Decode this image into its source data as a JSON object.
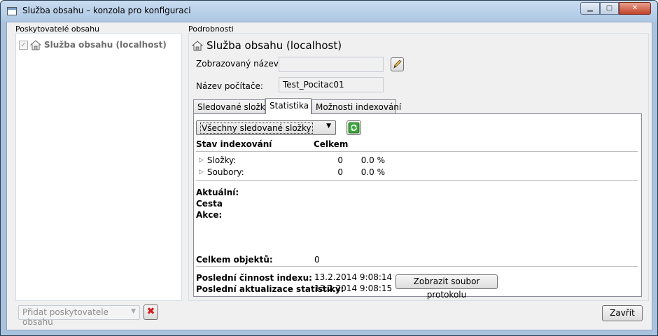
{
  "window": {
    "title": "Služba obsahu – konzola pro konfiguraci",
    "minimize_glyph": "▁",
    "maximize_glyph": "▢",
    "close_glyph": "✕"
  },
  "providers": {
    "group_label": "Poskytovatelé obsahu",
    "items": [
      {
        "label": "Služba obsahu (localhost)",
        "checked": true,
        "icon": "house-icon"
      }
    ],
    "add_combo_placeholder": "Přidat poskytovatele obsahu",
    "delete_glyph": "✖"
  },
  "details": {
    "group_label": "Podrobnosti",
    "title": "Služba obsahu (localhost)",
    "display_name_label": "Zobrazovaný název:",
    "display_name_value": "",
    "computer_name_label": "Název počítače:",
    "computer_name_value": "Test_Pocitac01"
  },
  "tabs": [
    {
      "label": "Sledované složky",
      "active": false
    },
    {
      "label": "Statistika",
      "active": true
    },
    {
      "label": "Možnosti indexování",
      "active": false
    }
  ],
  "statistics": {
    "folder_filter_selected": "Všechny sledované složky",
    "columns": {
      "state": "Stav indexování",
      "total": "Celkem"
    },
    "rows": [
      {
        "label": "Složky:",
        "count": "0",
        "percent": "0.0 %"
      },
      {
        "label": "Soubory:",
        "count": "0",
        "percent": "0.0 %"
      }
    ],
    "current_label": "Aktuální:",
    "path_label": "Cesta",
    "action_label": "Akce:",
    "total_objects_label": "Celkem objektů:",
    "total_objects_value": "0",
    "last_index_activity_label": "Poslední činnost indexu:",
    "last_index_activity_value": "13.2.2014 9:08:14",
    "last_stats_update_label": "Poslední aktualizace statistiky:",
    "last_stats_update_value": "13.2.2014 9:08:15",
    "show_log_button": "Zobrazit soubor protokolu"
  },
  "footer": {
    "close_button": "Zavřít"
  },
  "colors": {
    "accent_blue": "#a9c3df",
    "close_red": "#c2432a",
    "refresh_green": "#2e9a2e",
    "delete_red": "#d41818"
  }
}
